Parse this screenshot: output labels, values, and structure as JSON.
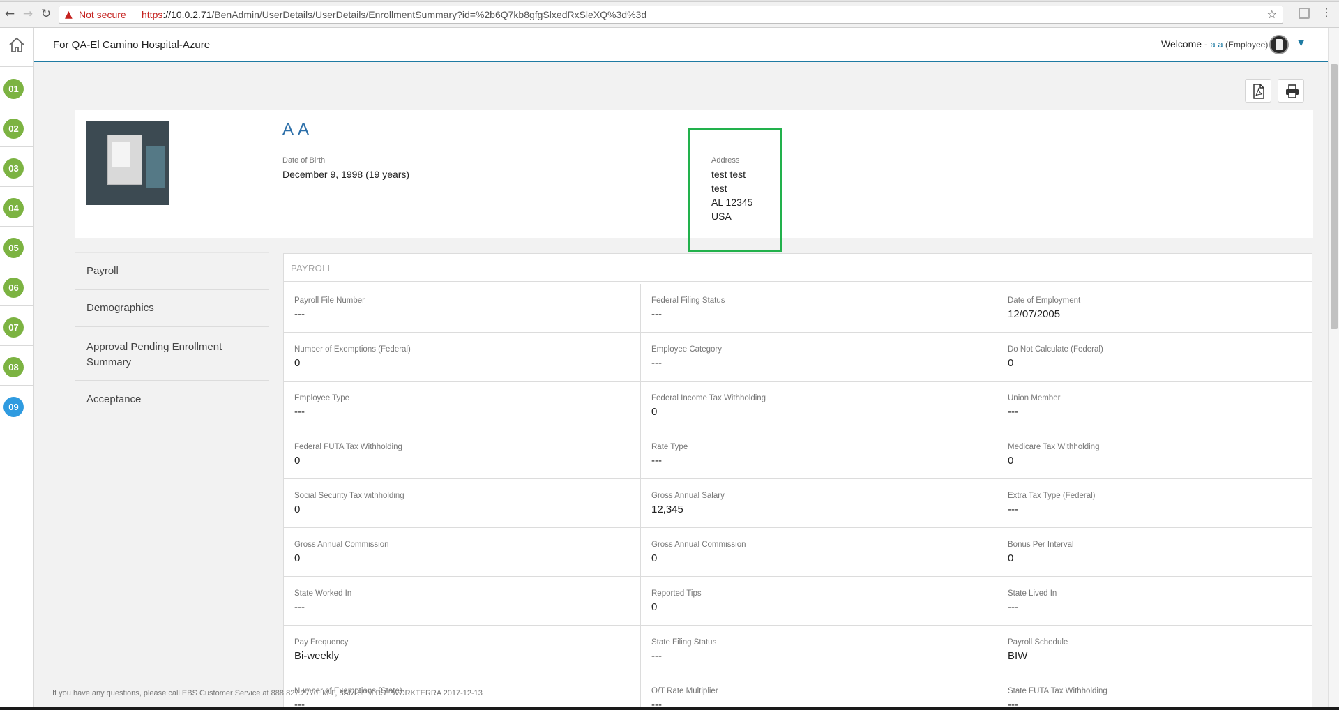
{
  "browser": {
    "security_warning": "Not secure",
    "url_scheme": "https",
    "url_host": "://10.0.2.71",
    "url_path": "/BenAdmin/UserDetails/UserDetails/EnrollmentSummary?id=%2b6Q7kb8gfgSlxedRxSleXQ%3d%3d"
  },
  "header": {
    "org": "For QA-El Camino Hospital-Azure",
    "welcome_prefix": "Welcome - ",
    "user_name": "a a",
    "user_role": " (Employee)"
  },
  "steps": [
    "01",
    "02",
    "03",
    "04",
    "05",
    "06",
    "07",
    "08",
    "09"
  ],
  "profile": {
    "name": "A A",
    "dob_label": "Date of Birth",
    "dob_value": "December 9, 1998 (19 years)",
    "address_label": "Address",
    "address_line1": "test test",
    "address_line2": "test",
    "address_line3": "AL  12345",
    "address_line4": "USA"
  },
  "side_menu": {
    "items": [
      {
        "label": "Payroll"
      },
      {
        "label": "Demographics"
      },
      {
        "label": "Approval Pending Enrollment Summary"
      },
      {
        "label": "Acceptance"
      }
    ]
  },
  "payroll": {
    "title": "PAYROLL",
    "rows": [
      [
        {
          "label": "Payroll File Number",
          "value": "---"
        },
        {
          "label": "Federal Filing Status",
          "value": "---"
        },
        {
          "label": "Date of Employment",
          "value": "12/07/2005"
        }
      ],
      [
        {
          "label": "Number of Exemptions (Federal)",
          "value": "0"
        },
        {
          "label": "Employee Category",
          "value": "---"
        },
        {
          "label": "Do Not Calculate (Federal)",
          "value": "0"
        }
      ],
      [
        {
          "label": "Employee Type",
          "value": "---"
        },
        {
          "label": "Federal Income Tax Withholding",
          "value": "0"
        },
        {
          "label": "Union Member",
          "value": "---"
        }
      ],
      [
        {
          "label": "Federal FUTA Tax Withholding",
          "value": "0"
        },
        {
          "label": "Rate Type",
          "value": "---"
        },
        {
          "label": "Medicare Tax Withholding",
          "value": "0"
        }
      ],
      [
        {
          "label": "Social Security Tax withholding",
          "value": "0"
        },
        {
          "label": "Gross Annual Salary",
          "value": "12,345"
        },
        {
          "label": "Extra Tax Type (Federal)",
          "value": "---"
        }
      ],
      [
        {
          "label": "Gross Annual Commission",
          "value": "0"
        },
        {
          "label": "Gross Annual Commission",
          "value": "0"
        },
        {
          "label": "Bonus Per Interval",
          "value": "0"
        }
      ],
      [
        {
          "label": "State Worked In",
          "value": "---"
        },
        {
          "label": "Reported Tips",
          "value": "0"
        },
        {
          "label": "State Lived In",
          "value": "---"
        }
      ],
      [
        {
          "label": "Pay Frequency",
          "value": "Bi-weekly"
        },
        {
          "label": "State Filing Status",
          "value": "---"
        },
        {
          "label": "Payroll Schedule",
          "value": "BIW"
        }
      ],
      [
        {
          "label": "Number of Exemptions (State)",
          "value": "---"
        },
        {
          "label": "O/T Rate Multiplier",
          "value": "---"
        },
        {
          "label": "State FUTA Tax Withholding",
          "value": "---"
        }
      ]
    ]
  },
  "footer": {
    "text": "If you have any questions, please call EBS Customer Service at 888.827.2770, M-F, 8AM-5PM PST.WORKTERRA 2017-12-13"
  },
  "colors": {
    "accent": "#1f7ba3",
    "step_done": "#7cb342",
    "step_active": "#2f9be0",
    "highlight_box": "#22b14c",
    "name_blue": "#2b6ea8"
  }
}
